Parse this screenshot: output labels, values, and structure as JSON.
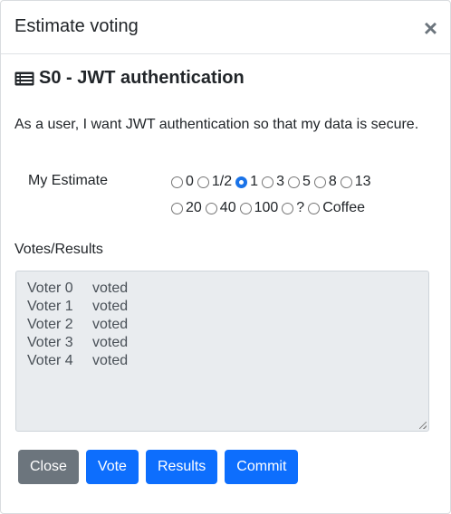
{
  "modal": {
    "title": "Estimate voting",
    "close_glyph": "×"
  },
  "story": {
    "icon": "list-alt-icon",
    "title": "S0 - JWT authentication",
    "description": "As a user, I want JWT authentication so that my data is secure."
  },
  "estimate": {
    "label": "My Estimate",
    "options": [
      "0",
      "1/2",
      "1",
      "3",
      "5",
      "8",
      "13",
      "20",
      "40",
      "100",
      "?",
      "Coffee"
    ],
    "selected": "1"
  },
  "votes": {
    "label": "Votes/Results",
    "rows": [
      {
        "name": "Voter 0",
        "status": "voted"
      },
      {
        "name": "Voter 1",
        "status": "voted"
      },
      {
        "name": "Voter 2",
        "status": "voted"
      },
      {
        "name": "Voter 3",
        "status": "voted"
      },
      {
        "name": "Voter 4",
        "status": "voted"
      }
    ]
  },
  "buttons": {
    "close": "Close",
    "vote": "Vote",
    "results": "Results",
    "commit": "Commit"
  },
  "colors": {
    "primary": "#0d6efd",
    "secondary": "#6c757d",
    "readonly_bg": "#e9ecef"
  }
}
